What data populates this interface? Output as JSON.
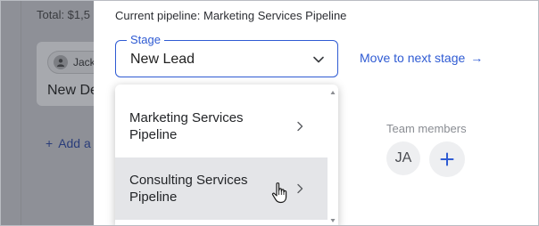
{
  "background": {
    "total_text": "Total: $1,5",
    "card_chip_text": "Jack",
    "card_deal_text": "New De",
    "add_text": "Add a"
  },
  "panel": {
    "current_pipeline": "Current pipeline: Marketing Services Pipeline",
    "stage_legend": "Stage",
    "stage_value": "New Lead",
    "move_next_label": "Move to next stage",
    "move_next_arrow": "→",
    "team_members_label": "Team members",
    "avatar_initials": "JA",
    "add_member_symbol": "+"
  },
  "dropdown": {
    "options": [
      {
        "label": "Marketing Services Pipeline",
        "hovered": false
      },
      {
        "label": "Consulting Services Pipeline",
        "hovered": true
      }
    ]
  },
  "colors": {
    "accent": "#2f5bd3",
    "overlay": "#8e9097",
    "hover": "#e4e5e8"
  }
}
